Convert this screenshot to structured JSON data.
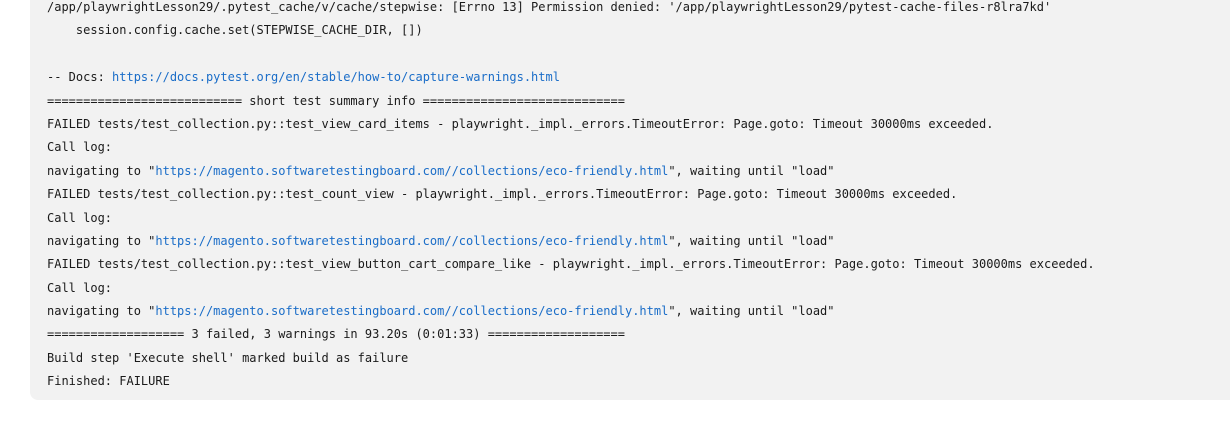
{
  "console": {
    "lines": [
      {
        "segments": [
          {
            "text": "/app/playwrightLesson29/.pytest_cache/v/cache/stepwise: [Errno 13] Permission denied: '/app/playwrightLesson29/pytest-cache-files-r8lra7kd'"
          }
        ]
      },
      {
        "segments": [
          {
            "text": "    session.config.cache.set(STEPWISE_CACHE_DIR, [])"
          }
        ]
      },
      {
        "segments": [
          {
            "text": ""
          }
        ]
      },
      {
        "segments": [
          {
            "text": "-- Docs: "
          },
          {
            "text": "https://docs.pytest.org/en/stable/how-to/capture-warnings.html",
            "link": true
          }
        ]
      },
      {
        "segments": [
          {
            "text": "=========================== short test summary info ============================"
          }
        ]
      },
      {
        "segments": [
          {
            "text": "FAILED tests/test_collection.py::test_view_card_items - playwright._impl._errors.TimeoutError: Page.goto: Timeout 30000ms exceeded."
          }
        ]
      },
      {
        "segments": [
          {
            "text": "Call log:"
          }
        ]
      },
      {
        "segments": [
          {
            "text": "navigating to \""
          },
          {
            "text": "https://magento.softwaretestingboard.com//collections/eco-friendly.html",
            "link": true
          },
          {
            "text": "\", waiting until \"load\""
          }
        ]
      },
      {
        "segments": [
          {
            "text": "FAILED tests/test_collection.py::test_count_view - playwright._impl._errors.TimeoutError: Page.goto: Timeout 30000ms exceeded."
          }
        ]
      },
      {
        "segments": [
          {
            "text": "Call log:"
          }
        ]
      },
      {
        "segments": [
          {
            "text": "navigating to \""
          },
          {
            "text": "https://magento.softwaretestingboard.com//collections/eco-friendly.html",
            "link": true
          },
          {
            "text": "\", waiting until \"load\""
          }
        ]
      },
      {
        "segments": [
          {
            "text": "FAILED tests/test_collection.py::test_view_button_cart_compare_like - playwright._impl._errors.TimeoutError: Page.goto: Timeout 30000ms exceeded."
          }
        ]
      },
      {
        "segments": [
          {
            "text": "Call log:"
          }
        ]
      },
      {
        "segments": [
          {
            "text": "navigating to \""
          },
          {
            "text": "https://magento.softwaretestingboard.com//collections/eco-friendly.html",
            "link": true
          },
          {
            "text": "\", waiting until \"load\""
          }
        ]
      },
      {
        "segments": [
          {
            "text": "=================== 3 failed, 3 warnings in 93.20s (0:01:33) ==================="
          }
        ]
      },
      {
        "segments": [
          {
            "text": "Build step 'Execute shell' marked build as failure"
          }
        ]
      },
      {
        "segments": [
          {
            "text": "Finished: FAILURE"
          }
        ]
      }
    ]
  },
  "colors": {
    "panel_background": "#f2f2f2",
    "text": "#1a1a1a",
    "link": "#1a6dc8"
  }
}
